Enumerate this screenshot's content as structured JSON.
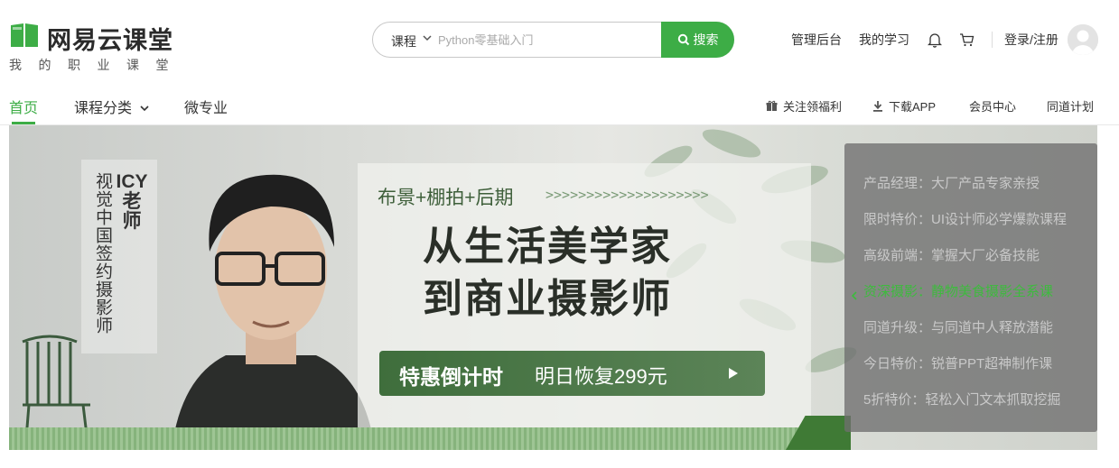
{
  "brand": {
    "name": "网易云课堂",
    "slogan": "我的职业课堂",
    "accent": "#3dad46"
  },
  "search": {
    "category": "课程",
    "placeholder": "Python零基础入门",
    "button_label": "搜索"
  },
  "top_links": {
    "admin": "管理后台",
    "my_learning": "我的学习",
    "login": "登录/注册"
  },
  "nav": {
    "home": "首页",
    "categories": "课程分类",
    "micro_major": "微专业",
    "follow_welfare": "关注领福利",
    "download_app": "下载APP",
    "member_center": "会员中心",
    "tongdao_plan": "同道计划"
  },
  "banner": {
    "teacher_name": "ICY老师",
    "teacher_title": "视觉中国签约摄影师",
    "subtitle": "布景+棚拍+后期",
    "arrows": ">>>>>>>>>>>>>>>>>>>>",
    "title_line1": "从生活美学家",
    "title_line2": "到商业摄影师",
    "countdown_bold": "特惠倒计时",
    "countdown_text": "明日恢复299元"
  },
  "side_menu": [
    {
      "label": "产品经理：大厂产品专家亲授",
      "active": false
    },
    {
      "label": "限时特价：UI设计师必学爆款课程",
      "active": false
    },
    {
      "label": "高级前端：掌握大厂必备技能",
      "active": false
    },
    {
      "label": "资深摄影：静物美食摄影全系课",
      "active": true
    },
    {
      "label": "同道升级：与同道中人释放潜能",
      "active": false
    },
    {
      "label": "今日特价：锐普PPT超神制作课",
      "active": false
    },
    {
      "label": "5折特价：轻松入门文本抓取挖掘",
      "active": false
    }
  ]
}
